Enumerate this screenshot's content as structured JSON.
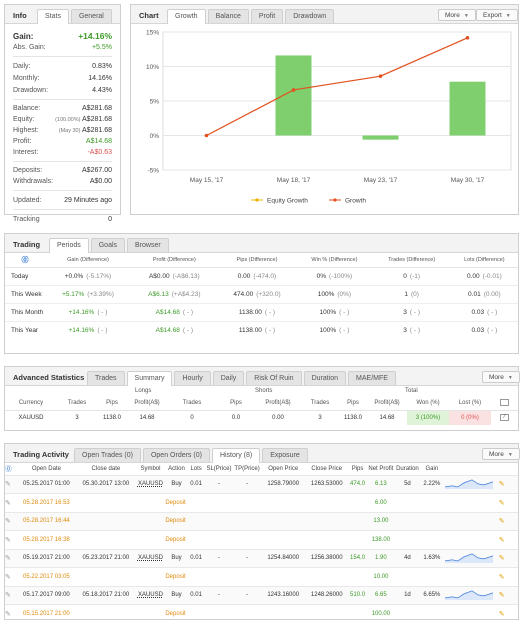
{
  "info": {
    "title": "Info",
    "tabs": [
      "Stats",
      "General"
    ],
    "gain_label": "Gain:",
    "gain": "+14.16%",
    "abs_label": "Abs. Gain:",
    "abs": "+5.5%",
    "stats": [
      [
        "Daily:",
        "0.83%"
      ],
      [
        "Monthly:",
        "14.16%"
      ],
      [
        "Drawdown:",
        "4.43%"
      ]
    ],
    "balance_label": "Balance:",
    "balance": "A$281.68",
    "equity_label": "Equity:",
    "equity_pct": "(100.00%)",
    "equity": "A$281.68",
    "highest_label": "Highest:",
    "highest_date": "(May 30)",
    "highest": "A$281.68",
    "profit_label": "Profit:",
    "profit": "A$14.68",
    "interest_label": "Interest:",
    "interest": "-A$0.63",
    "deposits_label": "Deposits:",
    "deposits": "A$267.00",
    "withdrawals_label": "Withdrawals:",
    "withdrawals": "A$0.00",
    "updated_label": "Updated:",
    "updated": "29 Minutes ago",
    "tracking_label": "Tracking",
    "tracking": "0"
  },
  "chart": {
    "title": "Chart",
    "tabs": [
      "Growth",
      "Balance",
      "Profit",
      "Drawdown"
    ],
    "more": "More",
    "export": "Export",
    "legend_equity": "Equity Growth",
    "legend_growth": "Growth",
    "bar_color": "#7fcf6f",
    "line_color": "#e3501e",
    "equity_color": "#f0b400"
  },
  "chart_data": {
    "type": "bar",
    "categories": [
      "May 15, '17",
      "May 18, '17",
      "May 23, '17",
      "May 30, '17"
    ],
    "series": [
      {
        "name": "Equity Growth",
        "values": [
          0,
          11.6,
          -0.6,
          7.8
        ]
      },
      {
        "name": "Growth",
        "values": [
          0,
          6.6,
          8.6,
          14.16
        ]
      }
    ],
    "ylim": [
      -5,
      15
    ],
    "yticks": [
      "15%",
      "10%",
      "5%",
      "0%",
      "-5%"
    ],
    "legend": "bottom"
  },
  "trading": {
    "title": "Trading",
    "tabs": [
      "Periods",
      "Goals",
      "Browser"
    ],
    "headers": [
      "Gain (Difference)",
      "Profit (Difference)",
      "Pips (Difference)",
      "Win % (Difference)",
      "Trades (Difference)",
      "Lots (Difference)"
    ],
    "rows": [
      {
        "label": "Today",
        "gain": "+0.0%",
        "gain_d": "(-5.17%)",
        "profit": "A$0.00",
        "profit_d": "(-A$6.13)",
        "pips": "0.00",
        "pips_d": "(-474.0)",
        "win": "0%",
        "win_d": "(-100%)",
        "trades": "0",
        "trades_d": "(-1)",
        "lots": "0.00",
        "lots_d": "(-0.01)"
      },
      {
        "label": "This Week",
        "gain": "+5.17%",
        "gain_d": "(+3.39%)",
        "profit": "A$6.13",
        "profit_d": "(+A$4.23)",
        "pips": "474.00",
        "pips_d": "(+320.0)",
        "win": "100%",
        "win_d": "(0%)",
        "trades": "1",
        "trades_d": "(0)",
        "lots": "0.01",
        "lots_d": "(0.00)"
      },
      {
        "label": "This Month",
        "gain": "+14.16%",
        "gain_d": "( - )",
        "profit": "A$14.68",
        "profit_d": "( - )",
        "pips": "1138.00",
        "pips_d": "( - )",
        "win": "100%",
        "win_d": "( - )",
        "trades": "3",
        "trades_d": "( - )",
        "lots": "0.03",
        "lots_d": "( - )"
      },
      {
        "label": "This Year",
        "gain": "+14.16%",
        "gain_d": "( - )",
        "profit": "A$14.68",
        "profit_d": "( - )",
        "pips": "1138.00",
        "pips_d": "( - )",
        "win": "100%",
        "win_d": "( - )",
        "trades": "3",
        "trades_d": "( - )",
        "lots": "0.03",
        "lots_d": "( - )"
      }
    ]
  },
  "adv": {
    "title": "Advanced Statistics",
    "tabs": [
      "Trades",
      "Summary",
      "Hourly",
      "Daily",
      "Risk Of Ruin",
      "Duration",
      "MAE/MFE"
    ],
    "more": "More",
    "groups": [
      "Longs",
      "Shorts",
      "Total"
    ],
    "headers": [
      "Currency",
      "Trades",
      "Pips",
      "Profit(A$)",
      "Trades",
      "Pips",
      "Profit(A$)",
      "Trades",
      "Pips",
      "Profit(A$)",
      "Won (%)",
      "Lost (%)"
    ],
    "row": [
      "XAUUSD",
      "3",
      "1138.0",
      "14.68",
      "0",
      "0.0",
      "0.00",
      "3",
      "1138.0",
      "14.68",
      "3 (100%)",
      "0 (0%)"
    ]
  },
  "activity": {
    "title": "Trading Activity",
    "tabs": [
      "Open Trades (0)",
      "Open Orders (0)",
      "History (8)",
      "Exposure"
    ],
    "more": "More",
    "headers": [
      "Open Date",
      "Close date",
      "Symbol",
      "Action",
      "Lots",
      "SL(Price)",
      "TP(Price)",
      "Open Price",
      "Close Price",
      "Pips",
      "Net Profit",
      "Duration",
      "Gain"
    ],
    "rows": [
      {
        "type": "trade",
        "open": "05.25.2017 01:00",
        "close": "05.30.2017 13:00",
        "symbol": "XAUUSD",
        "action": "Buy",
        "lots": "0.01",
        "sl": "-",
        "tp": "-",
        "op": "1258.79000",
        "cp": "1263.53000",
        "pips": "474.0",
        "net": "6.13",
        "dur": "5d",
        "gain": "2.22%"
      },
      {
        "type": "deposit",
        "open": "05.28.2017 16:53",
        "action": "Deposit",
        "net": "6.00"
      },
      {
        "type": "deposit",
        "open": "05.28.2017 16:44",
        "action": "Deposit",
        "net": "13.00"
      },
      {
        "type": "deposit",
        "open": "05.28.2017 16:38",
        "action": "Deposit",
        "net": "138.00"
      },
      {
        "type": "trade",
        "open": "05.19.2017 21:00",
        "close": "05.23.2017 21:00",
        "symbol": "XAUUSD",
        "action": "Buy",
        "lots": "0.01",
        "sl": "-",
        "tp": "-",
        "op": "1254.84000",
        "cp": "1256.38000",
        "pips": "154.0",
        "net": "1.90",
        "dur": "4d",
        "gain": "1.63%"
      },
      {
        "type": "deposit",
        "open": "05.22.2017 03:05",
        "action": "Deposit",
        "net": "10.00"
      },
      {
        "type": "trade",
        "open": "05.17.2017 09:00",
        "close": "05.18.2017 21:00",
        "symbol": "XAUUSD",
        "action": "Buy",
        "lots": "0.01",
        "sl": "-",
        "tp": "-",
        "op": "1243.16000",
        "cp": "1248.26000",
        "pips": "510.0",
        "net": "6.65",
        "dur": "1d",
        "gain": "6.65%"
      },
      {
        "type": "deposit",
        "open": "05.15.2017 21:00",
        "action": "Deposit",
        "net": "100.00"
      }
    ]
  }
}
